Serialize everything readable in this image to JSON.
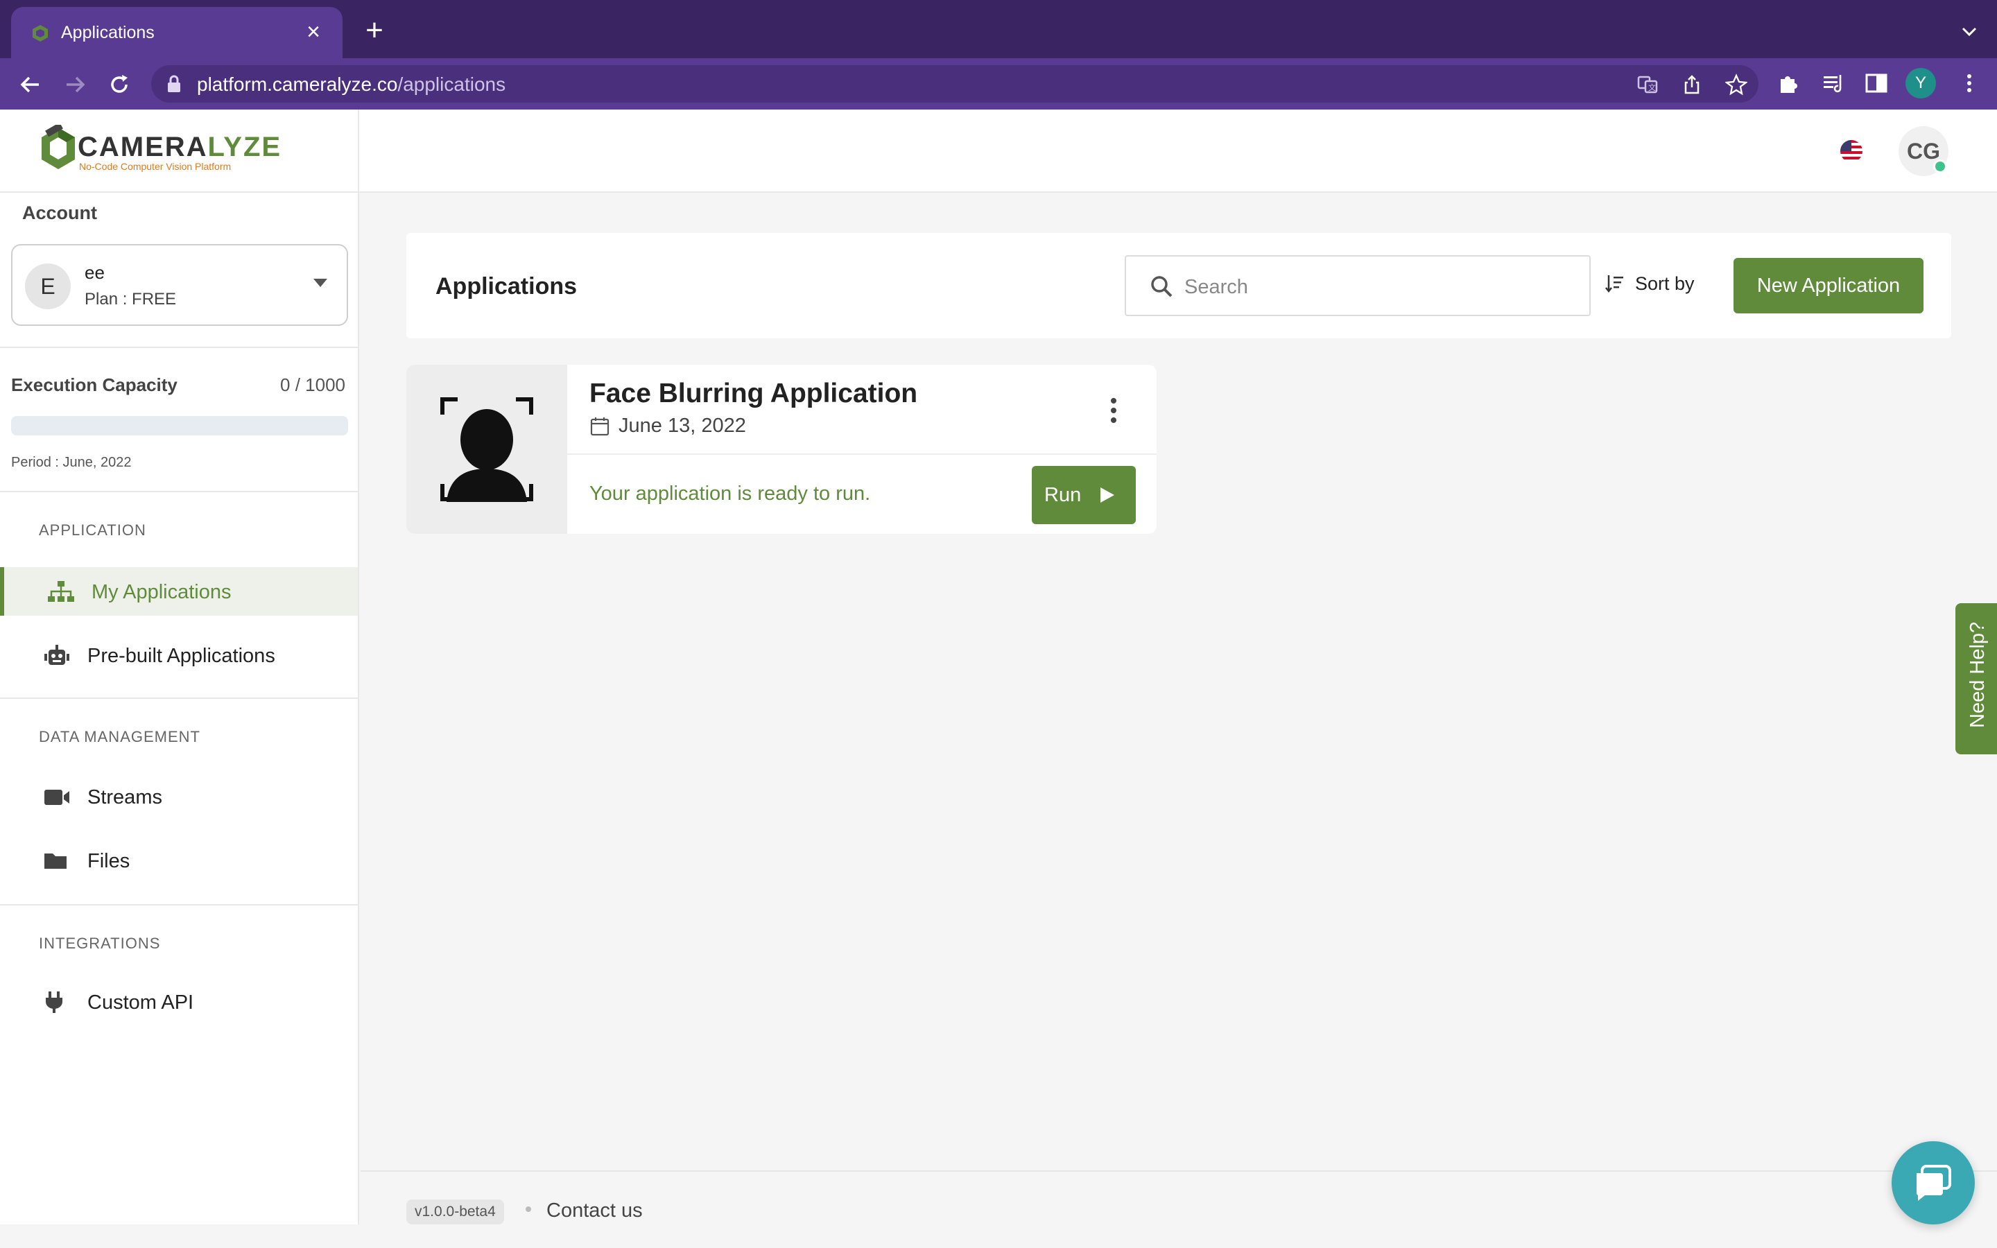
{
  "browser": {
    "tab_title": "Applications",
    "url_host": "platform.cameralyze.co",
    "url_path": "/applications",
    "profile_initial": "Y"
  },
  "header": {
    "logo_main": "CAMERA",
    "logo_accent": "LYZE",
    "logo_tagline": "No-Code Computer Vision Platform",
    "user_initials": "CG"
  },
  "sidebar": {
    "account_label": "Account",
    "account": {
      "initial": "E",
      "name": "ee",
      "plan": "Plan : FREE"
    },
    "capacity": {
      "label": "Execution Capacity",
      "value": "0 / 1000",
      "fill": 0,
      "period": "Period : June, 2022"
    },
    "sections": {
      "application": "APPLICATION",
      "data_management": "DATA MANAGEMENT",
      "integrations": "INTEGRATIONS"
    },
    "items": [
      {
        "label": "My Applications",
        "icon": "sitemap-icon",
        "active": true
      },
      {
        "label": "Pre-built Applications",
        "icon": "robot-icon",
        "active": false
      },
      {
        "label": "Streams",
        "icon": "video-camera-icon",
        "active": false
      },
      {
        "label": "Files",
        "icon": "folder-icon",
        "active": false
      },
      {
        "label": "Custom API",
        "icon": "plug-icon",
        "active": false
      }
    ]
  },
  "main": {
    "title": "Applications",
    "search_placeholder": "Search",
    "sort_label": "Sort by",
    "new_app_label": "New Application",
    "apps": [
      {
        "name": "Face Blurring Application",
        "date": "June 13, 2022",
        "status": "Your application is ready to run.",
        "run_label": "Run"
      }
    ]
  },
  "need_help_label": "Need Help?",
  "footer": {
    "version": "v1.0.0-beta4",
    "contact": "Contact us"
  },
  "colors": {
    "accent": "#5f8b3a",
    "chrome": "#5a3b93",
    "chat": "#3aa9b4"
  }
}
